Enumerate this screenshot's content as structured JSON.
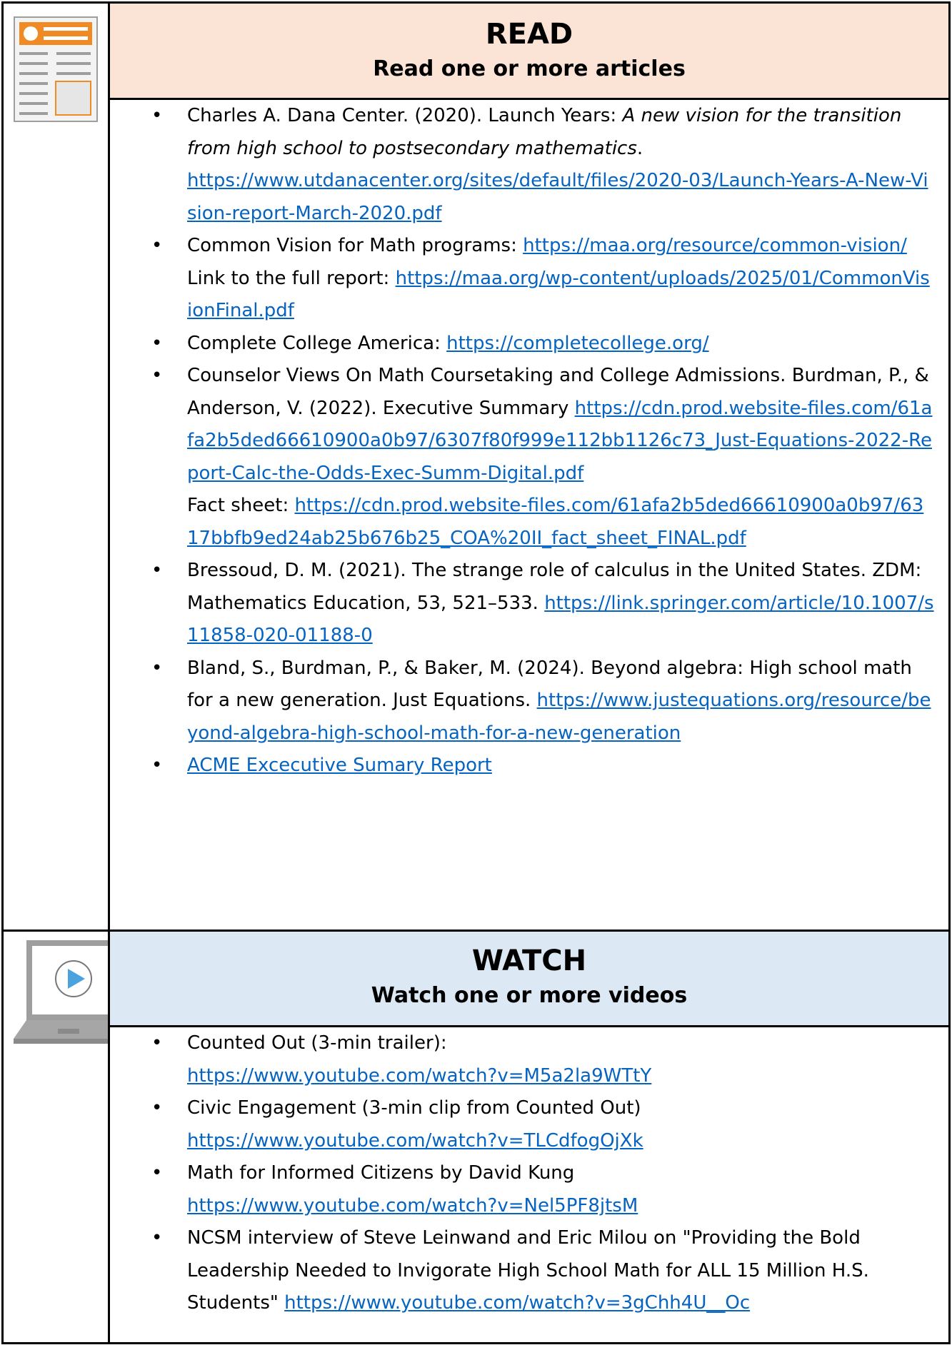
{
  "read": {
    "title": "READ",
    "subtitle": "Read one or more articles",
    "icon": "document-icon",
    "items": [
      {
        "pre": "Charles A. Dana Center. (2020). Launch Years: ",
        "italic": "A new vision for the transition from high school to postsecondary mathematics",
        "post": ".",
        "url": "https://www.utdanacenter.org/sites/default/files/2020-03/Launch-Years-A-New-Vision-report-March-2020.pdf"
      },
      {
        "pre": "Common Vision for Math programs: ",
        "url": "https://maa.org/resource/common-vision/",
        "pre2": "Link to the full report: ",
        "url2": "https://maa.org/wp-content/uploads/2025/01/CommonVisionFinal.pdf"
      },
      {
        "pre": "Complete College America: ",
        "url": "https://completecollege.org/"
      },
      {
        "pre": "Counselor Views On Math Coursetaking and College Admissions. Burdman, P., & Anderson, V. (2022). Executive Summary ",
        "url": "https://cdn.prod.website-files.com/61afa2b5ded66610900a0b97/6307f80f999e112bb1126c73_Just-Equations-2022-Report-Calc-the-Odds-Exec-Summ-Digital.pdf",
        "pre2": "Fact sheet: ",
        "url2": "https://cdn.prod.website-files.com/61afa2b5ded66610900a0b97/6317bbfb9ed24ab25b676b25_COA%20II_fact_sheet_FINAL.pdf"
      },
      {
        "pre": "Bressoud, D. M. (2021). The strange role of calculus in the United States. ZDM: Mathematics Education, 53, 521–533. ",
        "url": "https://link.springer.com/article/10.1007/s11858-020-01188-0"
      },
      {
        "pre": "Bland, S., Burdman, P., & Baker, M. (2024). Beyond algebra: High school math for a new generation. Just Equations. ",
        "url": "https://www.justequations.org/resource/beyond-algebra-high-school-math-for-a-new-generation"
      },
      {
        "url": "ACME Excecutive Sumary Report"
      }
    ]
  },
  "watch": {
    "title": "WATCH",
    "subtitle": "Watch one or more videos",
    "icon": "laptop-play-icon",
    "items": [
      {
        "pre": "Counted Out (3-min trailer):",
        "url": "https://www.youtube.com/watch?v=M5a2la9WTtY"
      },
      {
        "pre": "Civic Engagement (3-min clip from Counted Out)",
        "url": "https://www.youtube.com/watch?v=TLCdfogOjXk"
      },
      {
        "pre": "Math for Informed Citizens by David Kung",
        "url": "https://www.youtube.com/watch?v=Nel5PF8jtsM"
      },
      {
        "pre": "NCSM interview of Steve Leinwand and Eric Milou on \"Providing the Bold Leadership Needed to Invigorate High School Math for ALL 15 Million H.S. Students\" ",
        "url": "https://www.youtube.com/watch?v=3gChh4U__Oc"
      }
    ]
  },
  "colors": {
    "read_header_bg": "#fbe4d5",
    "watch_header_bg": "#dce9f5",
    "link": "#0563c1",
    "icon_accent_orange": "#f08a24",
    "icon_accent_blue": "#4aa3df"
  }
}
